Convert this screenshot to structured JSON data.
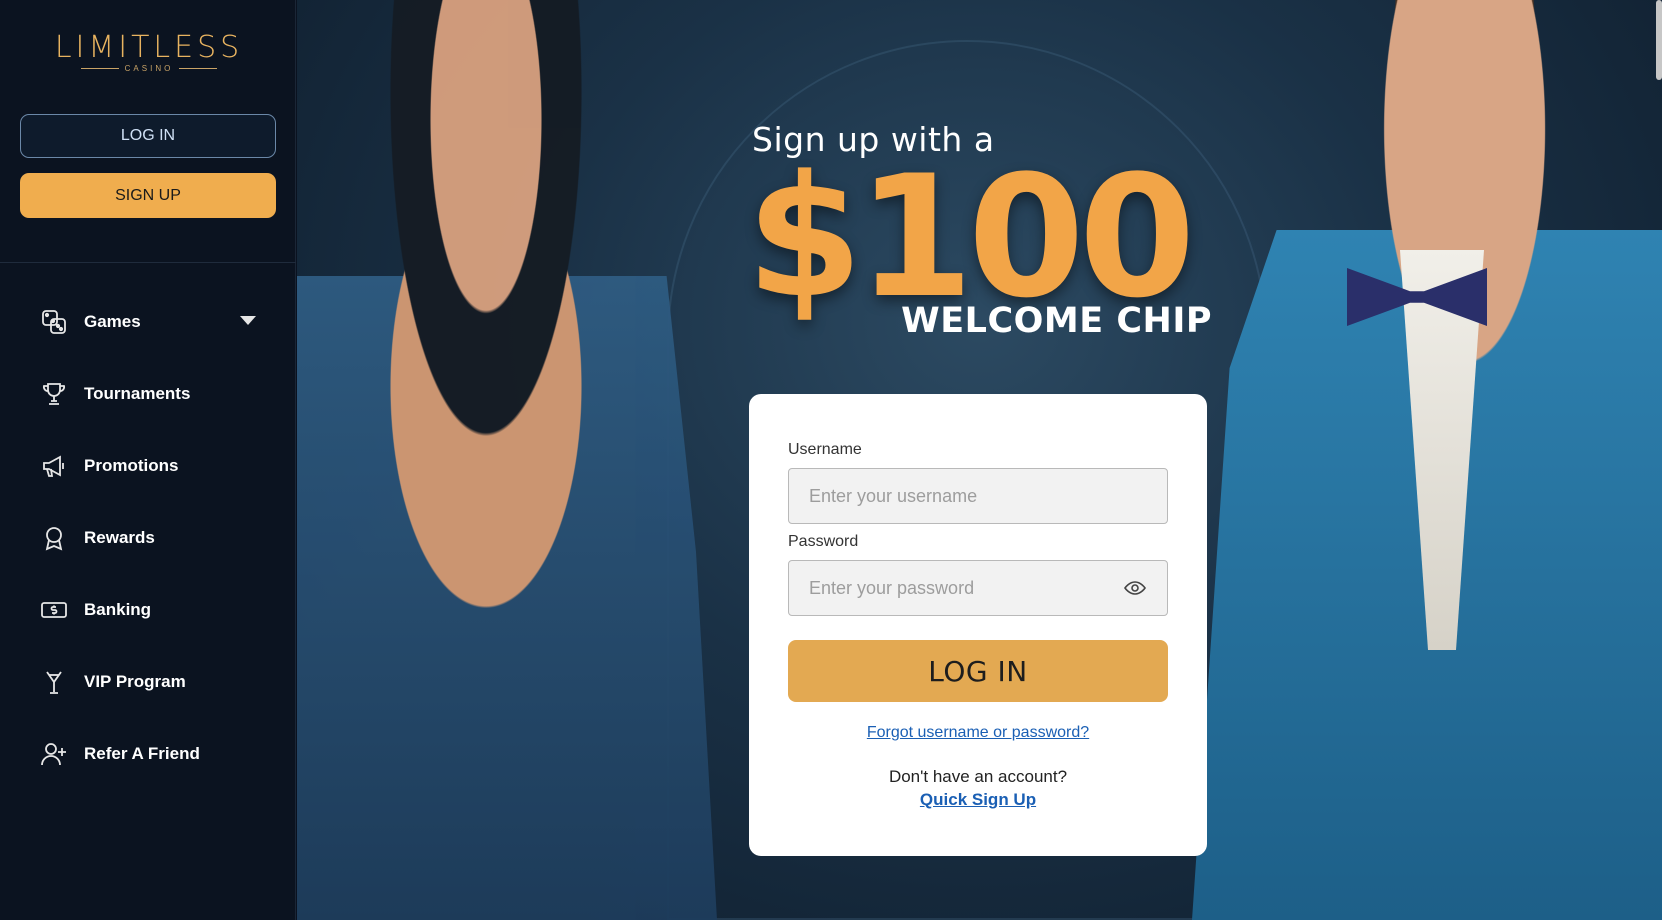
{
  "brand": {
    "logo_word": "LIMITLESS",
    "logo_sub": "CASINO"
  },
  "sidebar": {
    "login_label": "LOG IN",
    "signup_label": "SIGN UP",
    "items": [
      {
        "label": "Games",
        "icon": "dice-icon"
      },
      {
        "label": "Tournaments",
        "icon": "trophy-icon"
      },
      {
        "label": "Promotions",
        "icon": "megaphone-icon"
      },
      {
        "label": "Rewards",
        "icon": "award-icon"
      },
      {
        "label": "Banking",
        "icon": "cash-icon"
      },
      {
        "label": "VIP Program",
        "icon": "vip-cocktail-icon"
      },
      {
        "label": "Refer A Friend",
        "icon": "add-user-icon"
      }
    ]
  },
  "promo": {
    "line1": "Sign up with a",
    "amount": "$100",
    "line2": "WELCOME CHIP"
  },
  "login_form": {
    "username_label": "Username",
    "username_placeholder": "Enter your username",
    "password_label": "Password",
    "password_placeholder": "Enter your password",
    "submit_label": "LOG IN",
    "forgot_link": "Forgot username or password?",
    "no_account_text": "Don't have an account?",
    "quick_signup_link": "Quick Sign Up"
  },
  "colors": {
    "sidebar_bg": "#0b1320",
    "accent_orange": "#f0ad4e",
    "link_blue": "#1a5fb4",
    "promo_gold": "#f2a548"
  }
}
